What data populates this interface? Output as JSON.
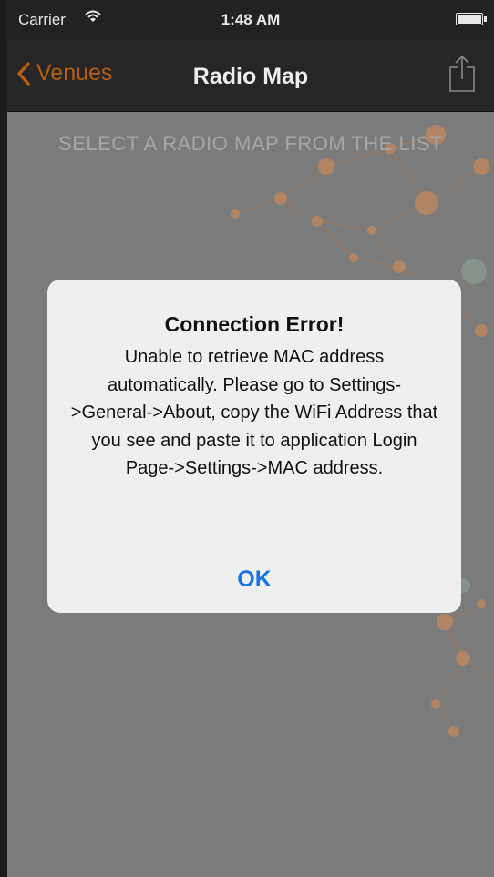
{
  "status_bar": {
    "carrier": "Carrier",
    "time": "1:48 AM"
  },
  "nav_bar": {
    "back_label": "Venues",
    "title": "Radio Map",
    "accent_color": "#b35e12"
  },
  "content": {
    "instruction": "SELECT A RADIO MAP FROM THE LIST"
  },
  "alert": {
    "title": "Connection Error!",
    "message": "Unable to retrieve MAC address automatically. Please go to Settings->General->About, copy the WiFi Address that you see and paste it to application Login Page->Settings->MAC address.",
    "ok_label": "OK",
    "button_color": "#1a73e8"
  },
  "icons": {
    "back": "chevron-left-icon",
    "share": "share-icon",
    "wifi": "wifi-icon",
    "battery": "battery-icon"
  }
}
